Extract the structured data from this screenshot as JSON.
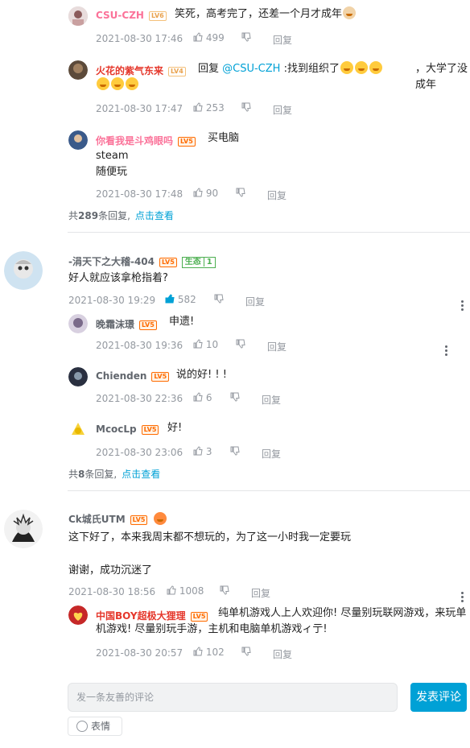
{
  "colors": {
    "accent": "#00a1d6",
    "pink_name": "#fb7299",
    "red_name": "#e5372b",
    "gray": "#9499a0"
  },
  "reply_label": "回复",
  "input_placeholder": "发一条友善的评论",
  "send_label": "发表评论",
  "emoji_label": "表情",
  "threads": [
    {
      "replies": [
        {
          "name": "CSU-CZH",
          "level": "LV6",
          "text": "笑死，高考完了，还差一个月才成年",
          "time": "2021-08-30 17:46",
          "likes": "499"
        },
        {
          "name": "火花的紫气东来",
          "level": "LV4",
          "text_prefix": "回复 ",
          "mention": "@CSU-CZH",
          "text": " :找到组织了",
          "text2": "，大学了没成年",
          "time": "2021-08-30 17:47",
          "likes": "253"
        },
        {
          "name": "你看我是斗鸡眼吗",
          "level": "LV5",
          "text": "买电脑",
          "line2": "steam",
          "line3": "随便玩",
          "time": "2021-08-30 17:48",
          "likes": "90"
        }
      ],
      "more_total": "289",
      "more_prefix": "共",
      "more_suffix": "条回复,",
      "more_link": "点击查看"
    },
    {
      "name": "-涓天下之大稽-404",
      "level": "LV5",
      "badge_label": "生态",
      "badge_num": "1",
      "text": "好人就应该拿枪指着?",
      "time": "2021-08-30 19:29",
      "likes": "582",
      "replies": [
        {
          "name": "晚霜沫璟",
          "level": "LV5",
          "text": "申遗!",
          "time": "2021-08-30 19:36",
          "likes": "10"
        },
        {
          "name": "Chienden",
          "level": "LV5",
          "text": "说的好! ! !",
          "time": "2021-08-30 22:36",
          "likes": "6"
        },
        {
          "name": "McocLp",
          "level": "LV5",
          "text": "好!",
          "time": "2021-08-30 23:06",
          "likes": "3"
        }
      ],
      "more_total": "8",
      "more_prefix": "共",
      "more_suffix": "条回复,",
      "more_link": "点击查看"
    },
    {
      "name": "Ck城氏UTM",
      "level": "LV5",
      "text": "这下好了，本来我周末都不想玩的，为了这一小时我一定要玩",
      "text2": "谢谢，成功沉迷了",
      "time": "2021-08-30 18:56",
      "likes": "1008",
      "replies": [
        {
          "name": "中国BOY超极大狸理",
          "level": "LV5",
          "text": "纯单机游戏人上人欢迎你! 尽量别玩联网游戏，来玩单机游戏! 尽量别玩手游，主机和电脑单机游戏ィ亍!",
          "time": "2021-08-30 20:57",
          "likes": "102"
        }
      ]
    }
  ]
}
